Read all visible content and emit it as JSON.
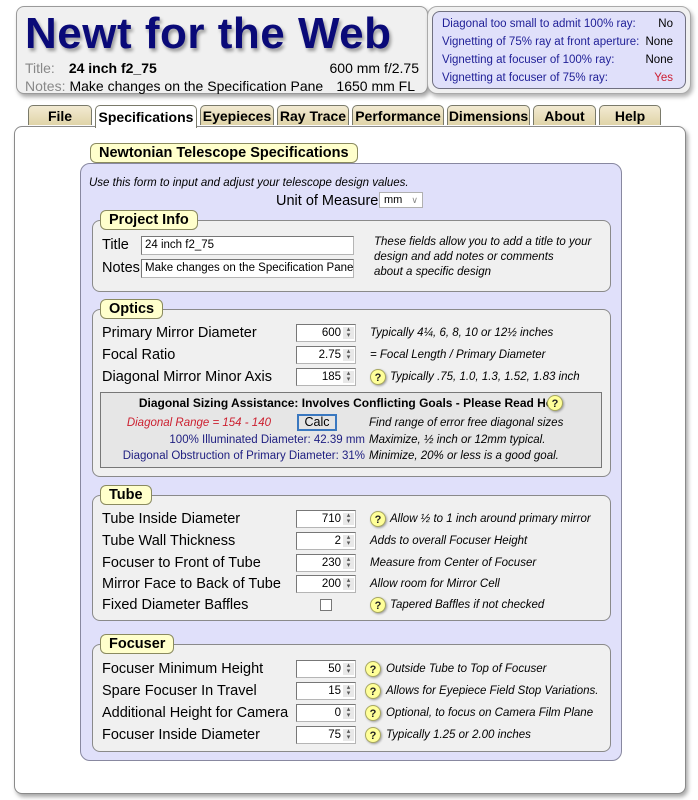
{
  "header": {
    "app_title": "Newt for the Web",
    "title_label": "Title:",
    "title_value": "24 inch f2_75",
    "notes_label": "Notes:",
    "notes_value": "Make changes on the Specification Pane",
    "aperture_summary": "600 mm f/2.75",
    "focal_length_summary": "1650 mm FL"
  },
  "status": [
    {
      "label": "Diagonal too small to admit 100% ray:",
      "value": "No",
      "alert": false
    },
    {
      "label": "Vignetting of 75% ray at front aperture:",
      "value": "None",
      "alert": false
    },
    {
      "label": "Vignetting at focuser of 100% ray:",
      "value": "None",
      "alert": false
    },
    {
      "label": "Vignetting at focuser of  75% ray:",
      "value": "Yes",
      "alert": true
    }
  ],
  "tabs": [
    {
      "label": "File",
      "active": false
    },
    {
      "label": "Specifications",
      "active": true
    },
    {
      "label": "Eyepieces",
      "active": false
    },
    {
      "label": "Ray Trace",
      "active": false
    },
    {
      "label": "Performance",
      "active": false
    },
    {
      "label": "Dimensions",
      "active": false
    },
    {
      "label": "About",
      "active": false
    },
    {
      "label": "Help",
      "active": false
    }
  ],
  "specs": {
    "heading": "Newtonian Telescope Specifications",
    "intro": "Use this form to input and adjust your telescope design values.",
    "unit_label": "Unit of Measure",
    "unit_value": "mm"
  },
  "project_info": {
    "heading": "Project Info",
    "title_label": "Title",
    "title_value": "24 inch f2_75",
    "notes_label": "Notes",
    "notes_value": "Make changes on the Specification Pane",
    "hint_lines": [
      "These fields allow you to add a title to your",
      "design and add notes or comments",
      "about a specific design"
    ]
  },
  "optics": {
    "heading": "Optics",
    "rows": [
      {
        "label": "Primary Mirror Diameter",
        "value": "600",
        "hint": "Typically 4¼, 6, 8, 10 or 12½ inches",
        "help": false
      },
      {
        "label": "Focal Ratio",
        "value": "2.75",
        "hint": "= Focal Length / Primary Diameter",
        "help": false
      },
      {
        "label": "Diagonal Mirror Minor Axis",
        "value": "185",
        "hint": "Typically .75, 1.0, 1.3, 1.52, 1.83 inch",
        "help": true
      }
    ],
    "diagonal_assist": {
      "title": "Diagonal Sizing Assistance: Involves Conflicting Goals - Please Read Help",
      "range_text": "Diagonal Range = 154 - 140",
      "calc_label": "Calc",
      "calc_hint": "Find range of error free diagonal sizes",
      "illum_text": "100% Illuminated Diameter: 42.39 mm",
      "illum_hint": "Maximize, ½ inch or 12mm typical.",
      "obstruction_text": "Diagonal Obstruction of Primary Diameter: 31%",
      "obstruction_hint": "Minimize, 20% or less is a good goal."
    }
  },
  "tube": {
    "heading": "Tube",
    "rows": [
      {
        "label": "Tube Inside Diameter",
        "value": "710",
        "hint": "Allow ½ to 1 inch around primary mirror",
        "help": true
      },
      {
        "label": "Tube Wall Thickness",
        "value": "2",
        "hint": "Adds to overall Focuser Height",
        "help": false
      },
      {
        "label": "Focuser to Front of Tube",
        "value": "230",
        "hint": "Measure from Center of Focuser",
        "help": false
      },
      {
        "label": "Mirror Face to Back of Tube",
        "value": "200",
        "hint": "Allow room for Mirror Cell",
        "help": false
      }
    ],
    "baffles_label": "Fixed Diameter Baffles",
    "baffles_checked": false,
    "baffles_hint": "Tapered Baffles if not checked"
  },
  "focuser": {
    "heading": "Focuser",
    "rows": [
      {
        "label": "Focuser Minimum Height",
        "value": "50",
        "hint": "Outside Tube to Top of Focuser",
        "help": true
      },
      {
        "label": "Spare Focuser In Travel",
        "value": "15",
        "hint": "Allows for Eyepiece Field Stop Variations.",
        "help": true
      },
      {
        "label": "Additional Height for Camera",
        "value": "0",
        "hint": "Optional, to focus on Camera Film Plane",
        "help": true
      },
      {
        "label": "Focuser Inside Diameter",
        "value": "75",
        "hint": "Typically 1.25 or 2.00 inches",
        "help": true
      }
    ]
  },
  "icons": {
    "help": "?",
    "spin": "▲▼",
    "chevron": "∨"
  },
  "colors": {
    "title_navy": "#0a0a78",
    "status_text": "#1e1e96",
    "alert_red": "#cc1e32",
    "panel_lavender": "#e0e0fa",
    "legend_yellow": "#ffffcc"
  }
}
